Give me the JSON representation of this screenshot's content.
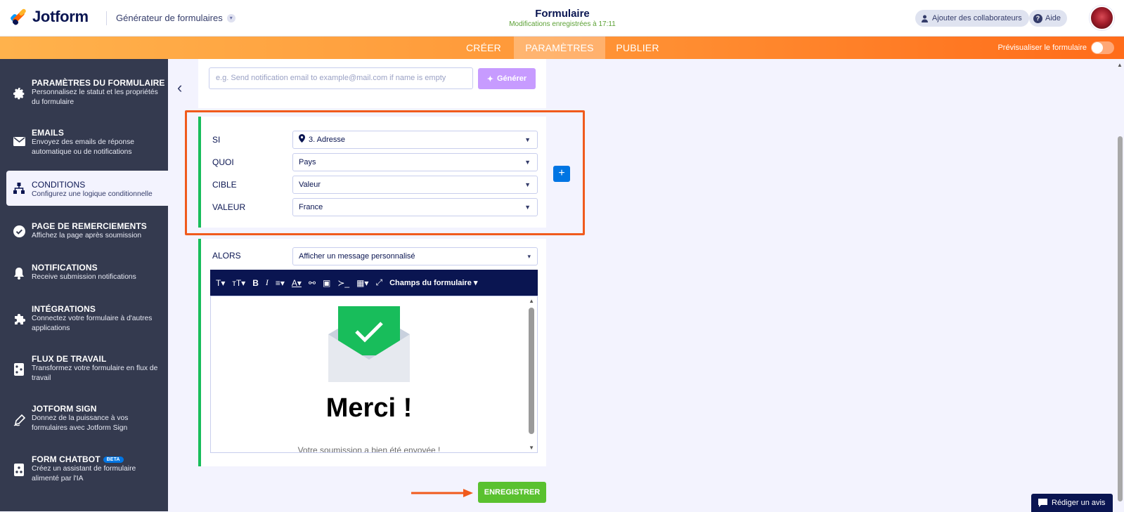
{
  "app": {
    "brand": "Jotform",
    "builder_label": "Générateur de formulaires"
  },
  "header": {
    "form_title": "Formulaire",
    "saved_status": "Modifications enregistrées à 17:11",
    "collab_label": "Ajouter des collaborateurs",
    "help_label": "Aide"
  },
  "tabs": [
    {
      "label": "CRÉER"
    },
    {
      "label": "PARAMÈTRES",
      "active": true
    },
    {
      "label": "PUBLIER"
    }
  ],
  "preview_label": "Prévisualiser le formulaire",
  "sidebar": {
    "items": [
      {
        "title": "PARAMÈTRES DU FORMULAIRE",
        "desc": "Personnalisez le statut et les propriétés du formulaire",
        "icon": "gear-icon"
      },
      {
        "title": "EMAILS",
        "desc": "Envoyez des emails de réponse automatique ou de notifications",
        "icon": "envelope-icon"
      },
      {
        "title": "CONDITIONS",
        "desc": "Configurez une logique conditionnelle",
        "icon": "sitemap-icon",
        "active": true
      },
      {
        "title": "PAGE DE REMERCIEMENTS",
        "desc": "Affichez la page après soumission",
        "icon": "check-circle-icon"
      },
      {
        "title": "NOTIFICATIONS",
        "desc": "Receive submission notifications",
        "icon": "bell-icon"
      },
      {
        "title": "INTÉGRATIONS",
        "desc": "Connectez votre formulaire à d'autres applications",
        "icon": "puzzle-icon"
      },
      {
        "title": "FLUX DE TRAVAIL",
        "desc": "Transformez votre formulaire en flux de travail",
        "icon": "workflow-icon"
      },
      {
        "title": "JOTFORM SIGN",
        "desc": "Donnez de la puissance à vos formulaires avec Jotform Sign",
        "icon": "pen-icon"
      },
      {
        "title": "FORM CHATBOT",
        "desc": "Créez un assistant de formulaire alimenté par l'IA",
        "icon": "chatbot-icon",
        "badge": "BETA"
      }
    ]
  },
  "ai": {
    "placeholder": "e.g. Send notification email to example@mail.com if name is empty",
    "generate_label": "Générer"
  },
  "condition": {
    "rows": [
      {
        "label": "SI",
        "value": "3. Adresse",
        "icon": "pin-icon"
      },
      {
        "label": "QUOI",
        "value": "Pays"
      },
      {
        "label": "CIBLE",
        "value": "Valeur"
      },
      {
        "label": "VALEUR",
        "value": "France"
      }
    ],
    "then_label": "ALORS",
    "then_value": "Afficher un message personnalisé"
  },
  "editor": {
    "fields_menu": "Champs du formulaire",
    "heading": "Merci !",
    "message": "Votre soumission a bien été envoyée !"
  },
  "save_label": "ENREGISTRER",
  "review_label": "Rédiger un avis",
  "colors": {
    "accent_orange": "#ff6c1a",
    "save_green": "#5ac12f",
    "highlight": "#f05a1c",
    "sidebar": "#343a4f",
    "primary": "#0a1551"
  }
}
